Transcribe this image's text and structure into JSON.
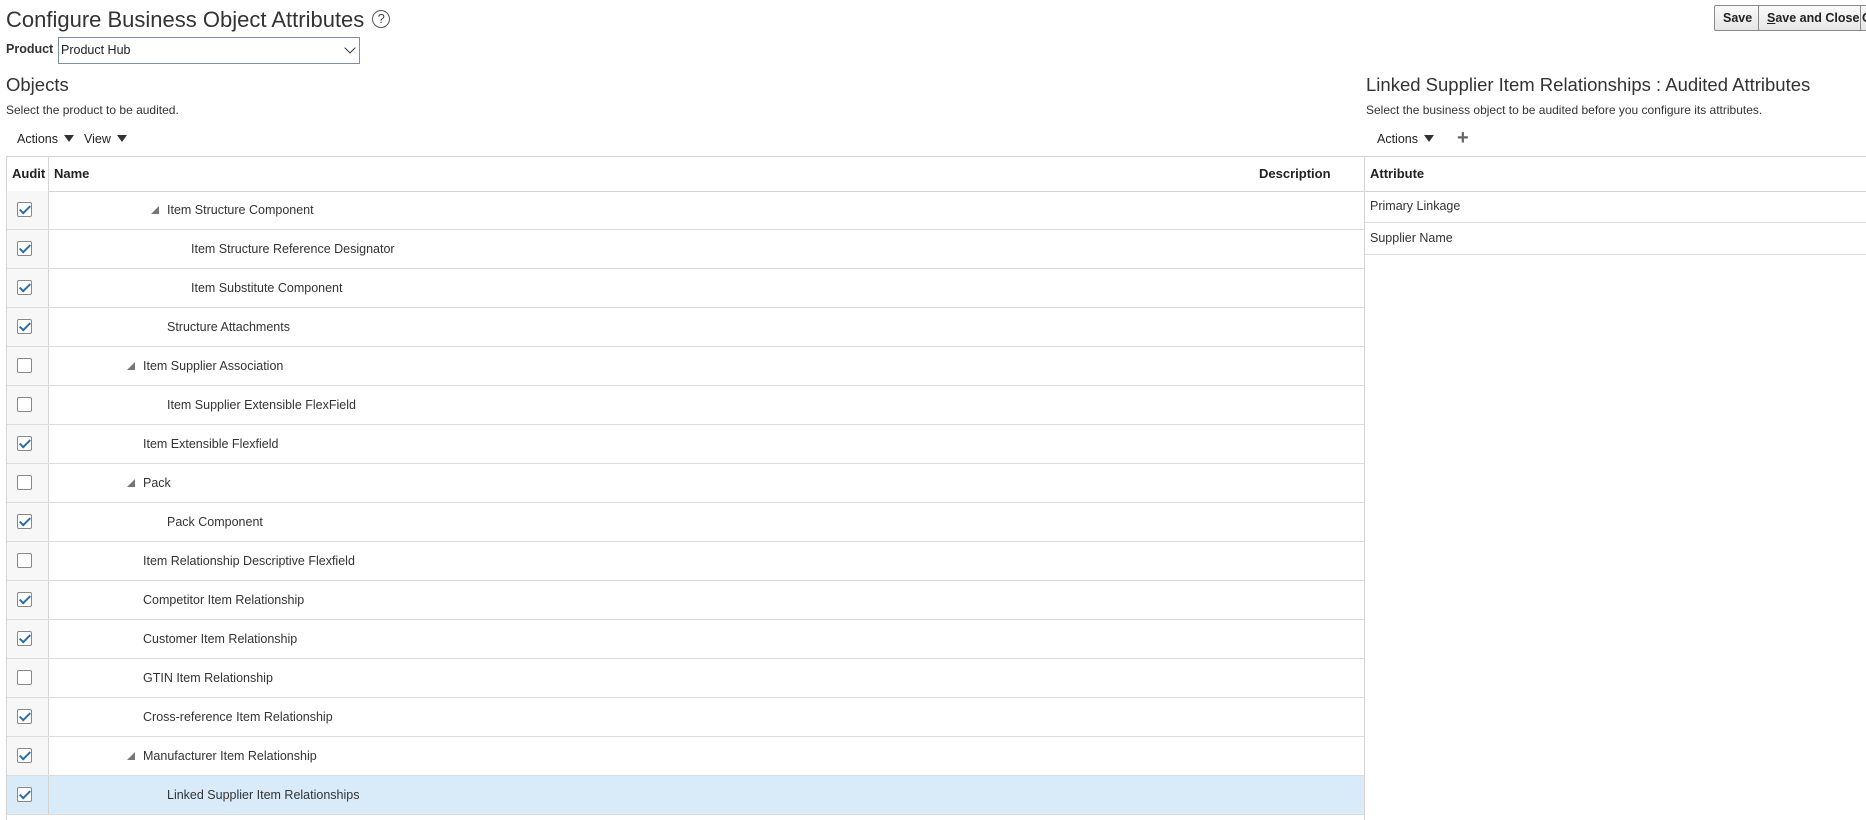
{
  "header": {
    "title": "Configure Business Object Attributes",
    "help_glyph": "?",
    "save_label": "Save",
    "save_close_label": "Save and Close",
    "save_close_mnemonic": "S",
    "save_close_rest": "ave and Close",
    "cut_label": "C"
  },
  "product": {
    "label": "Product",
    "value": "Product Hub"
  },
  "objects": {
    "title": "Objects",
    "hint": "Select the product to be audited.",
    "toolbar": {
      "actions_label": "Actions",
      "view_label": "View"
    },
    "columns": {
      "audit": "Audit",
      "name": "Name",
      "description": "Description"
    },
    "rows": [
      {
        "name": "Item Structure Component",
        "checked": true,
        "level": 3,
        "expandable": true
      },
      {
        "name": "Item Structure Reference Designator",
        "checked": true,
        "level": 4,
        "expandable": false
      },
      {
        "name": "Item Substitute Component",
        "checked": true,
        "level": 4,
        "expandable": false
      },
      {
        "name": "Structure Attachments",
        "checked": true,
        "level": 3,
        "expandable": false
      },
      {
        "name": "Item Supplier Association",
        "checked": false,
        "level": 2,
        "expandable": true
      },
      {
        "name": "Item Supplier Extensible FlexField",
        "checked": false,
        "level": 3,
        "expandable": false
      },
      {
        "name": "Item Extensible Flexfield",
        "checked": true,
        "level": 2,
        "expandable": false
      },
      {
        "name": "Pack",
        "checked": false,
        "level": 2,
        "expandable": true
      },
      {
        "name": "Pack Component",
        "checked": true,
        "level": 3,
        "expandable": false
      },
      {
        "name": "Item Relationship Descriptive Flexfield",
        "checked": false,
        "level": 2,
        "expandable": false
      },
      {
        "name": "Competitor Item Relationship",
        "checked": true,
        "level": 2,
        "expandable": false
      },
      {
        "name": "Customer Item Relationship",
        "checked": true,
        "level": 2,
        "expandable": false
      },
      {
        "name": "GTIN Item Relationship",
        "checked": false,
        "level": 2,
        "expandable": false
      },
      {
        "name": "Cross-reference Item Relationship",
        "checked": true,
        "level": 2,
        "expandable": false
      },
      {
        "name": "Manufacturer Item Relationship",
        "checked": true,
        "level": 2,
        "expandable": true
      },
      {
        "name": "Linked Supplier Item Relationships",
        "checked": true,
        "level": 3,
        "expandable": false,
        "selected": true
      }
    ]
  },
  "audited": {
    "title": "Linked Supplier Item Relationships : Audited Attributes",
    "hint": "Select the business object to be audited before you configure its attributes.",
    "toolbar": {
      "actions_label": "Actions",
      "add_icon": "plus-icon"
    },
    "column": "Attribute",
    "rows": [
      "Primary Linkage",
      "Supplier Name"
    ]
  },
  "colors": {
    "selected_row": "#d9ebf9",
    "check": "#2d6ea8"
  }
}
